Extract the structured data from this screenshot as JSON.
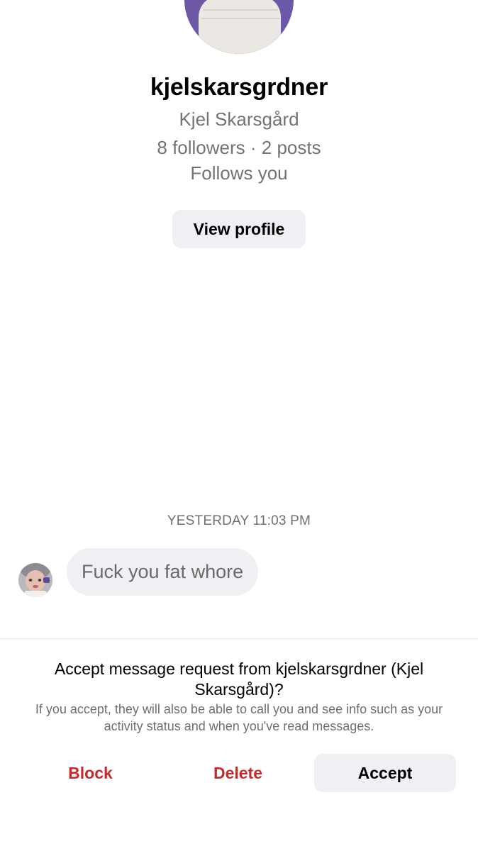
{
  "profile": {
    "username": "kjelskarsgrdner",
    "full_name": "Kjel Skarsgård",
    "stats": "8 followers · 2 posts",
    "relationship": "Follows you",
    "view_profile_label": "View profile"
  },
  "conversation": {
    "timestamp": "YESTERDAY 11:03 PM",
    "messages": [
      {
        "sender": "kjelskarsgrdner",
        "text": "Fuck you fat whore"
      }
    ]
  },
  "message_request": {
    "title": "Accept message request from kjelskarsgrdner (Kjel Skarsgård)?",
    "description": "If you accept, they will also be able to call you and see info such as your activity status and when you've read messages.",
    "block_label": "Block",
    "delete_label": "Delete",
    "accept_label": "Accept"
  },
  "colors": {
    "destructive": "#c62b2b",
    "secondary_text": "#737373",
    "button_background": "#efeff4",
    "bubble_background": "#efeff4"
  },
  "icons": {
    "profile_avatar": "avatar-photo-icon",
    "sender_avatar": "avatar-photo-icon"
  }
}
